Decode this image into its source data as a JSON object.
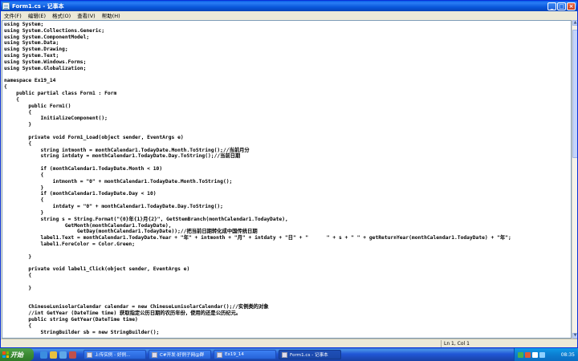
{
  "window": {
    "title": "Form1.cs - 记事本",
    "controls": {
      "minimize": "_",
      "maximize": "□",
      "close": "×"
    }
  },
  "menu": [
    "文件(F)",
    "编辑(E)",
    "格式(O)",
    "查看(V)",
    "帮助(H)"
  ],
  "editor": {
    "lines": [
      "using System;",
      "using System.Collections.Generic;",
      "using System.ComponentModel;",
      "using System.Data;",
      "using System.Drawing;",
      "using System.Text;",
      "using System.Windows.Forms;",
      "using System.Globalization;",
      "",
      "namespace Ex19_14",
      "{",
      "    public partial class Form1 : Form",
      "    {",
      "        public Form1()",
      "        {",
      "            InitializeComponent();",
      "        }",
      "",
      "        private void Form1_Load(object sender, EventArgs e)",
      "        {",
      "            string intmonth = monthCalendar1.TodayDate.Month.ToString();//当前月分",
      "            string intdaty = monthCalendar1.TodayDate.Day.ToString();//当前日期",
      "",
      "            if (monthCalendar1.TodayDate.Month < 10)",
      "            {",
      "                intmonth = \"0\" + monthCalendar1.TodayDate.Month.ToString();",
      "            }",
      "            if (monthCalendar1.TodayDate.Day < 10)",
      "            {",
      "                intdaty = \"0\" + monthCalendar1.TodayDate.Day.ToString();",
      "            }",
      "            string s = String.Format(\"{0}年{1}月{2}\", GetStemBranch(monthCalendar1.TodayDate),",
      "                    GetMonth(monthCalendar1.TodayDate),",
      "                        GetDay(monthCalendar1.TodayDate));//把当前日期转化成中国传统日期",
      "            label1.Text = monthCalendar1.TodayDate.Year + \"年\" + intmonth + \"月\" + intdaty + \"日\" + \"      \" + s + \" \" + getReturnYear(monthCalendar1.TodayDate) + \"年\";",
      "            label1.ForeColor = Color.Green;",
      "",
      "        }",
      "",
      "        private void label1_Click(object sender, EventArgs e)",
      "        {",
      "",
      "        }",
      "",
      "",
      "        ChineseLunisolarCalendar calendar = new ChineseLunisolarCalendar();//实例类的对象",
      "        //int GetYear (DateTime time) 获取指定公历日期的农历年份，使用的还是公历纪元。",
      "        public string GetYear(DateTime time)",
      "        {",
      "            StringBuilder sb = new StringBuilder();"
    ]
  },
  "status": {
    "position": "Ln 1, Col 1"
  },
  "taskbar": {
    "start_label": "开始",
    "tasks": [
      {
        "label": "上传实例 - 好例..."
      },
      {
        "label": "C#开发-好例子网@群"
      },
      {
        "label": "Ex19_14"
      },
      {
        "label": "Form1.cs - 记事本",
        "active": true
      }
    ],
    "clock": "08:35"
  }
}
